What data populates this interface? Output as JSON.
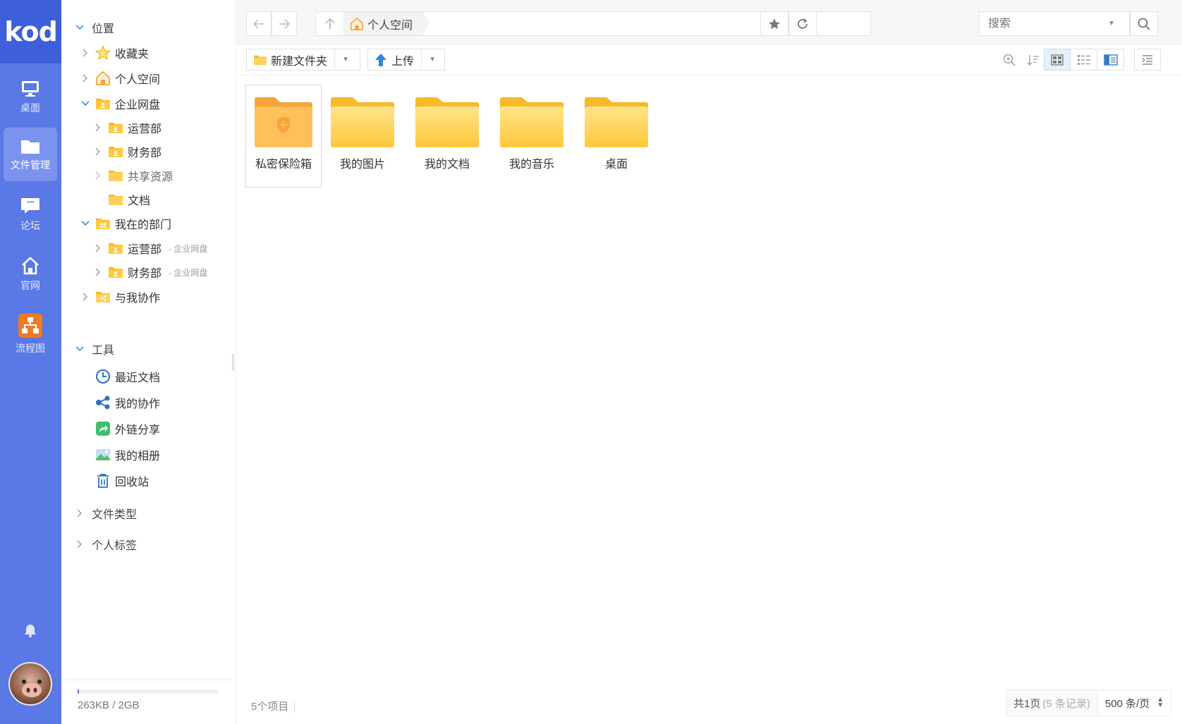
{
  "app": {
    "logo": "kod",
    "rail": [
      {
        "label": "桌面",
        "icon": "monitor-icon"
      },
      {
        "label": "文件管理",
        "icon": "folder-icon",
        "active": true
      },
      {
        "label": "论坛",
        "icon": "chat-icon"
      },
      {
        "label": "官网",
        "icon": "home-icon"
      },
      {
        "label": "流程图",
        "icon": "flowchart-icon"
      }
    ]
  },
  "tree": {
    "location": "位置",
    "favorites": "收藏夹",
    "personal_space": "个人空间",
    "enterprise_disk": "企业网盘",
    "enterprise_children": [
      "运营部",
      "财务部",
      "共享资源",
      "文档"
    ],
    "my_department": "我在的部门",
    "my_department_children": [
      {
        "label": "运营部",
        "suffix": "- 企业网盘"
      },
      {
        "label": "财务部",
        "suffix": "- 企业网盘"
      }
    ],
    "collab_with_me": "与我协作",
    "tools": "工具",
    "tool_items": [
      "最近文档",
      "我的协作",
      "外链分享",
      "我的相册",
      "回收站"
    ],
    "file_types": "文件类型",
    "personal_tags": "个人标签",
    "quota": "263KB / 2GB",
    "quota_used_fraction": 0.0001
  },
  "topbar": {
    "crumb": "个人空间",
    "search_placeholder": "搜索"
  },
  "toolbar": {
    "new_folder": "新建文件夹",
    "upload": "上传",
    "view_mode": "icon"
  },
  "files": [
    {
      "name": "私密保险箱",
      "type": "safe-folder",
      "selected": true
    },
    {
      "name": "我的图片",
      "type": "folder"
    },
    {
      "name": "我的文档",
      "type": "folder"
    },
    {
      "name": "我的音乐",
      "type": "folder"
    },
    {
      "name": "桌面",
      "type": "folder"
    }
  ],
  "status": {
    "count": "5个项目",
    "pages": "共1页",
    "records": "(5 条记录)",
    "per_page": "500 条/页"
  },
  "colors": {
    "rail": "#5a78e6",
    "rail_logo": "#3d5fd9",
    "folder": "#ffd15c",
    "folder_tab": "#f7b928"
  }
}
